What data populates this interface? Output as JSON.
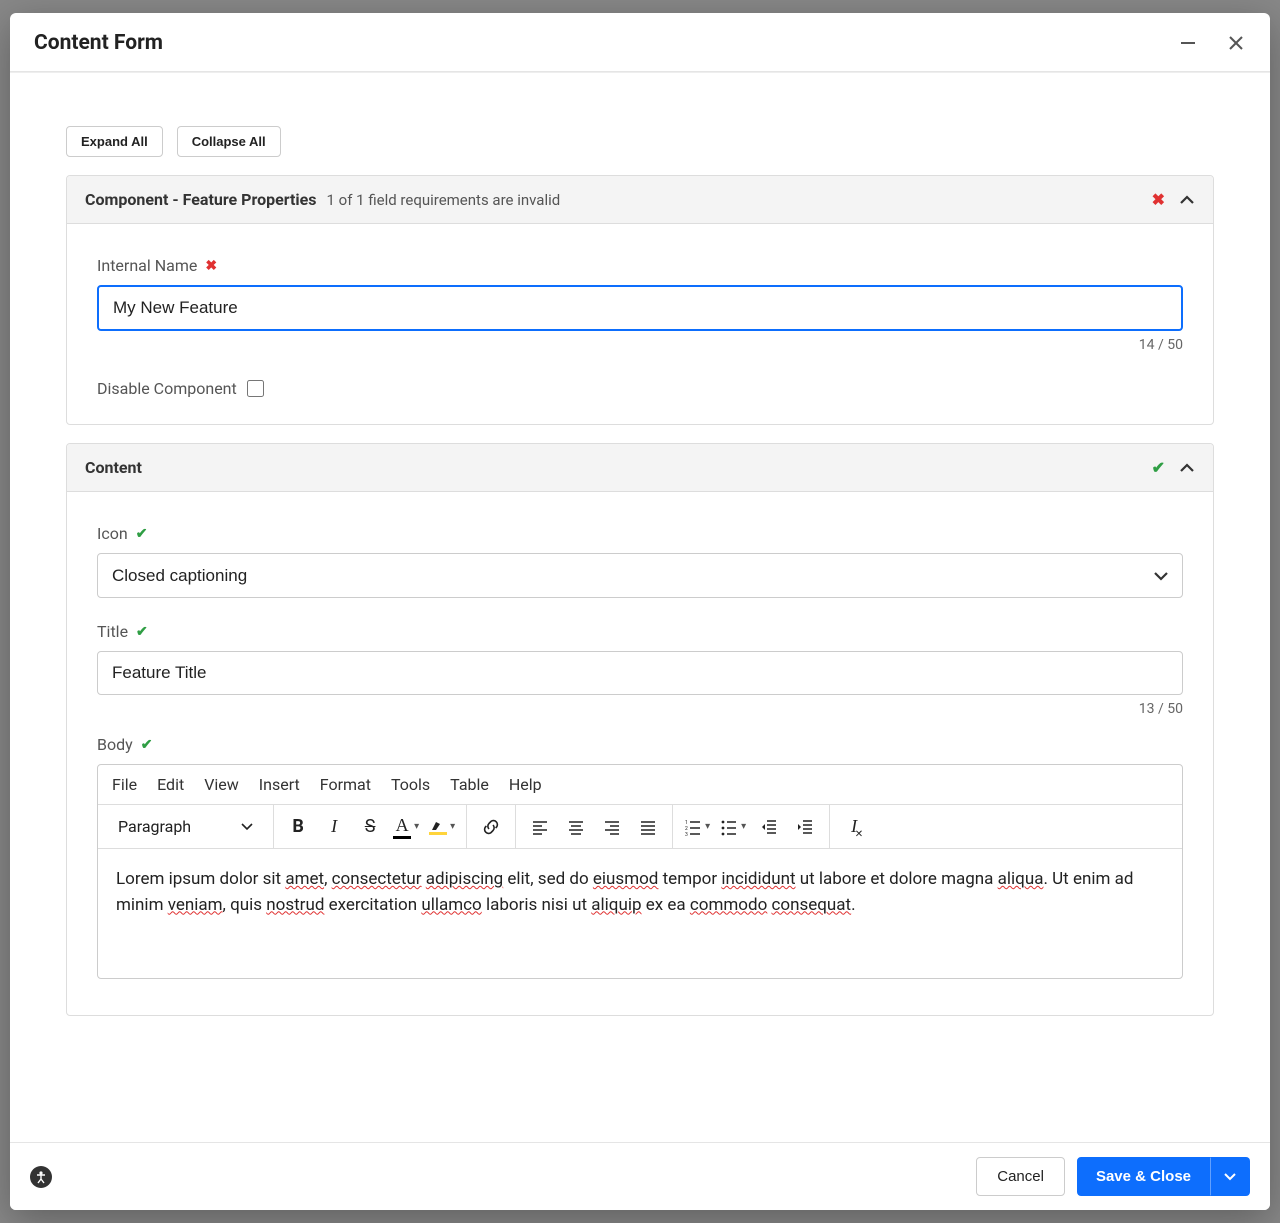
{
  "modal": {
    "title": "Content Form"
  },
  "toolbar": {
    "expand_all": "Expand All",
    "collapse_all": "Collapse All"
  },
  "panel1": {
    "title": "Component - Feature Properties",
    "subtitle": "1 of 1 field requirements are invalid",
    "internal_name_label": "Internal Name",
    "internal_name_value": "My New Feature",
    "internal_name_counter": "14 / 50",
    "disable_label": "Disable Component"
  },
  "panel2": {
    "title": "Content",
    "icon_label": "Icon",
    "icon_value": "Closed captioning",
    "title_label": "Title",
    "title_value": "Feature Title",
    "title_counter": "13 / 50",
    "body_label": "Body"
  },
  "editor": {
    "menu": {
      "file": "File",
      "edit": "Edit",
      "view": "View",
      "insert": "Insert",
      "format": "Format",
      "tools": "Tools",
      "table": "Table",
      "help": "Help"
    },
    "paragraph_label": "Paragraph",
    "body_text_plain": "Lorem ipsum dolor sit amet, consectetur adipiscing elit, sed do eiusmod tempor incididunt ut labore et dolore magna aliqua. Ut enim ad minim veniam, quis nostrud exercitation ullamco laboris nisi ut aliquip ex ea commodo consequat."
  },
  "footer": {
    "cancel": "Cancel",
    "save": "Save & Close"
  }
}
